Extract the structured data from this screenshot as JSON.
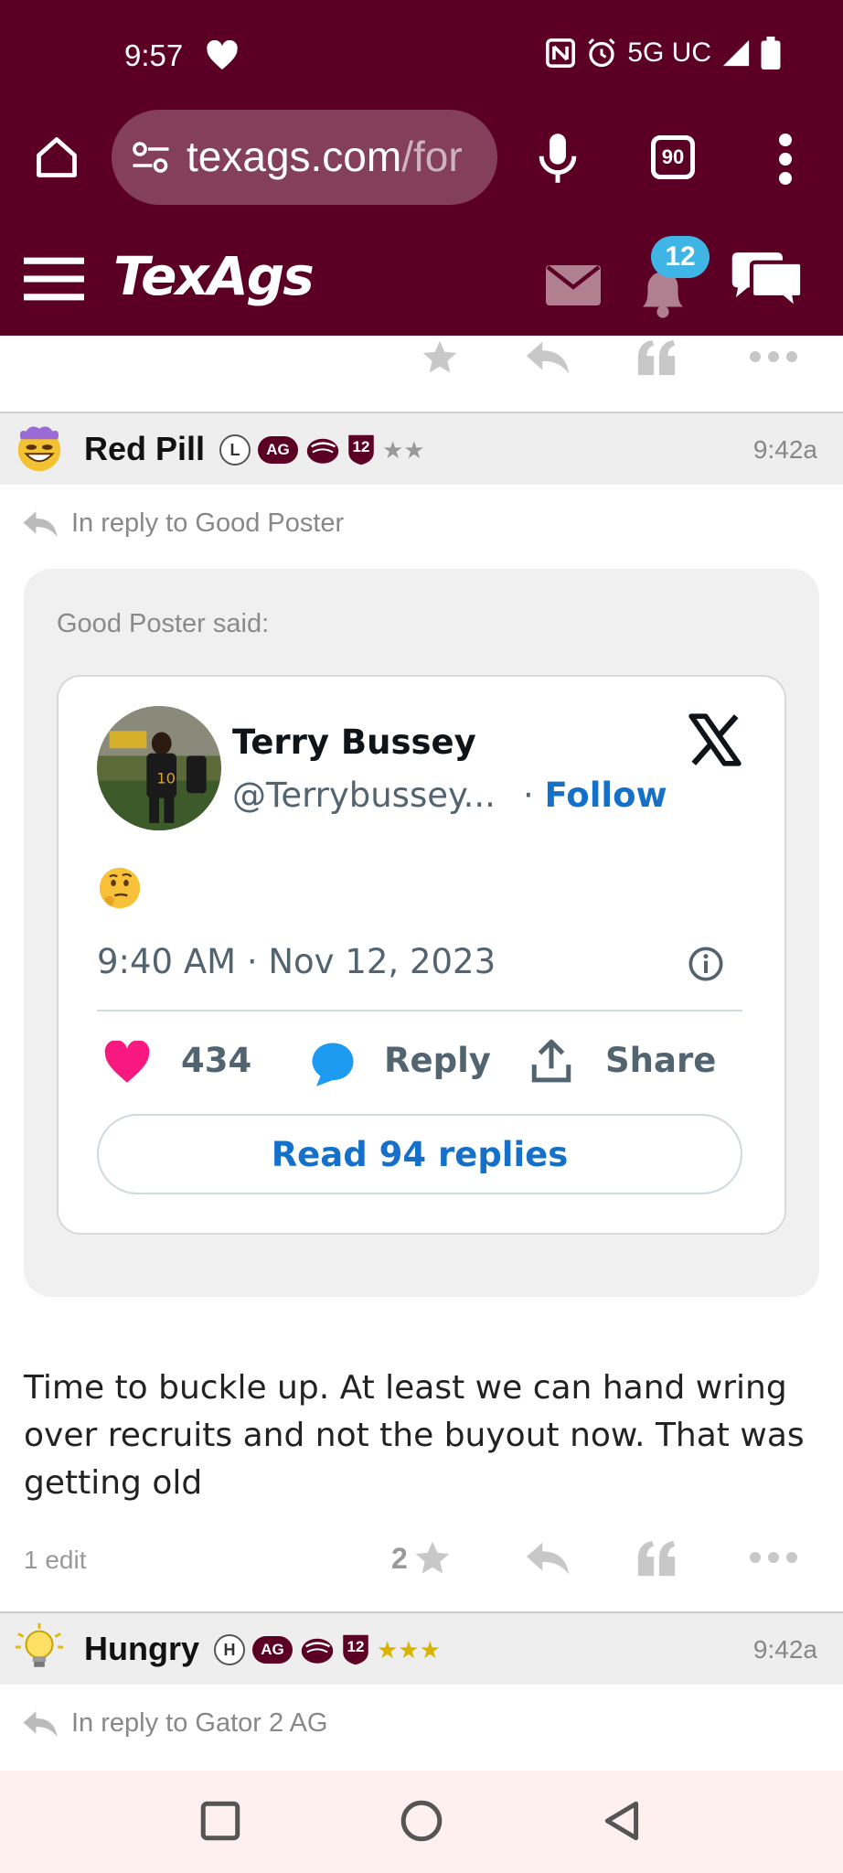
{
  "status_bar": {
    "time": "9:57",
    "network": "5G UC",
    "icons": [
      "heart-icon",
      "nfc-icon",
      "alarm-icon",
      "signal-icon",
      "battery-icon"
    ]
  },
  "browser": {
    "url_host": "texags.com",
    "url_rest": "/for",
    "tab_count": "90",
    "icons": [
      "home-icon",
      "tune-icon",
      "mic-icon",
      "tabs-icon",
      "more-vert-icon"
    ]
  },
  "site": {
    "logo": "TexAgs",
    "notification_count": "12",
    "icons": [
      "hamburger-icon",
      "mail-icon",
      "bell-icon",
      "chat-icon"
    ],
    "accent_color": "#5b0024"
  },
  "posts": [
    {
      "username": "Red Pill",
      "badge_letter": "L",
      "badge_ag": "AG",
      "badge_12": "12",
      "stars": "★★",
      "time": "9:42a",
      "reply_to": "In reply to Good Poster",
      "quote_label": "Good Poster said:",
      "tweet": {
        "name": "Terry Bussey",
        "handle": "@Terrybussey...",
        "follow_sep": "·",
        "follow": "Follow",
        "emoji": "🤔",
        "datetime": "9:40 AM · Nov 12, 2023",
        "likes": "434",
        "reply": "Reply",
        "share": "Share",
        "read_replies": "Read 94 replies"
      },
      "body": "Time to buckle up. At least we can hand wring over recruits and not the buyout now. That was getting old",
      "edits": "1 edit",
      "star_count": "2"
    },
    {
      "username": "Hungry",
      "badge_letter": "H",
      "badge_ag": "AG",
      "badge_12": "12",
      "stars": "★★★",
      "time": "9:42a",
      "reply_to": "In reply to Gator 2 AG"
    }
  ],
  "navigation": {
    "icons": [
      "recents-icon",
      "home-circle-icon",
      "back-icon"
    ]
  }
}
